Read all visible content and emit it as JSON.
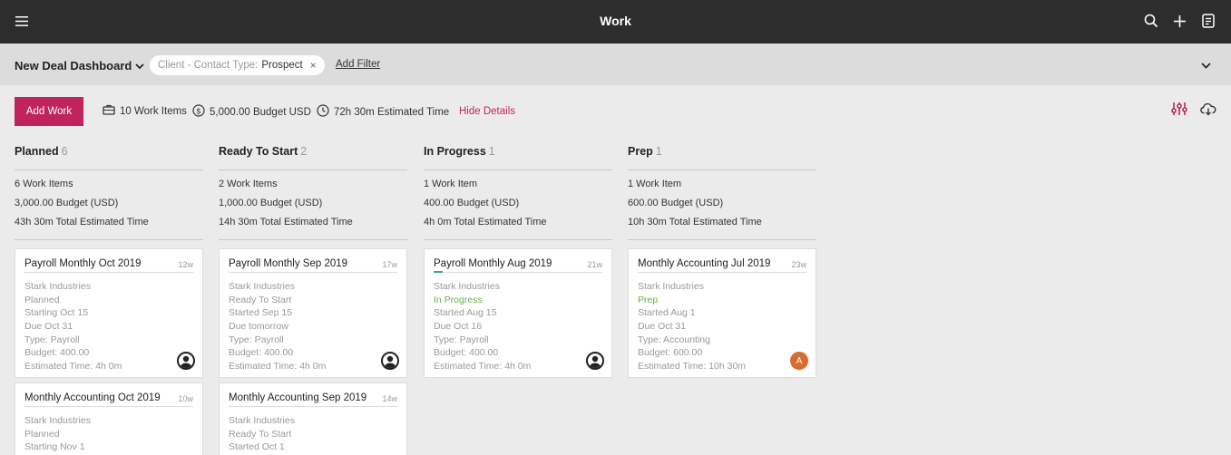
{
  "header": {
    "title": "Work"
  },
  "filterbar": {
    "dashboard": "New Deal Dashboard",
    "chip_key": "Client - Contact Type:",
    "chip_value": "Prospect",
    "chip_remove": "×",
    "add_filter": "Add Filter"
  },
  "toolbar": {
    "add_work": "Add Work",
    "work_items": "10 Work Items",
    "budget": "5,000.00 Budget USD",
    "estimated_time": "72h 30m Estimated Time",
    "hide_details": "Hide Details"
  },
  "accent_color": "#c0245c",
  "columns": [
    {
      "name": "Planned",
      "count": "6",
      "summary": [
        "6 Work Items",
        "3,000.00 Budget (USD)",
        "43h 30m Total Estimated Time"
      ],
      "cards": [
        {
          "title": "Payroll Monthly Oct 2019",
          "age": "12w",
          "client": "Stark Industries",
          "status": "Planned",
          "date1": "Starting Oct 15",
          "date2": "Due Oct 31",
          "type": "Type: Payroll",
          "budget": "Budget: 400.00",
          "est": "Estimated Time: 4h 0m",
          "avatar": "person-icon"
        },
        {
          "title": "Monthly Accounting Oct 2019",
          "age": "10w",
          "client": "Stark Industries",
          "status": "Planned",
          "date1": "Starting Nov 1"
        }
      ]
    },
    {
      "name": "Ready To Start",
      "count": "2",
      "summary": [
        "2 Work Items",
        "1,000.00 Budget (USD)",
        "14h 30m Total Estimated Time"
      ],
      "cards": [
        {
          "title": "Payroll Monthly Sep 2019",
          "age": "17w",
          "client": "Stark Industries",
          "status": "Ready To Start",
          "date1": "Started Sep 15",
          "date2": "Due tomorrow",
          "type": "Type: Payroll",
          "budget": "Budget: 400.00",
          "est": "Estimated Time: 4h 0m",
          "avatar": "person-icon"
        },
        {
          "title": "Monthly Accounting Sep 2019",
          "age": "14w",
          "client": "Stark Industries",
          "status": "Ready To Start",
          "date1": "Started Oct 1"
        }
      ]
    },
    {
      "name": "In Progress",
      "count": "1",
      "summary": [
        "1 Work Item",
        "400.00 Budget (USD)",
        "4h 0m Total Estimated Time"
      ],
      "cards": [
        {
          "title": "Payroll Monthly Aug 2019",
          "age": "21w",
          "client": "Stark Industries",
          "status": "In Progress",
          "date1": "Started Aug 15",
          "date2": "Due Oct 16",
          "type": "Type: Payroll",
          "budget": "Budget: 400.00",
          "est": "Estimated Time: 4h 0m",
          "avatar": "person-icon"
        }
      ]
    },
    {
      "name": "Prep",
      "count": "1",
      "summary": [
        "1 Work Item",
        "600.00 Budget (USD)",
        "10h 30m Total Estimated Time"
      ],
      "cards": [
        {
          "title": "Monthly Accounting Jul 2019",
          "age": "23w",
          "client": "Stark Industries",
          "status": "Prep",
          "date1": "Started Aug 1",
          "date2": "Due Oct 31",
          "type": "Type: Accounting",
          "budget": "Budget: 600.00",
          "est": "Estimated Time: 10h 30m",
          "avatar_letter": "A"
        }
      ]
    }
  ]
}
